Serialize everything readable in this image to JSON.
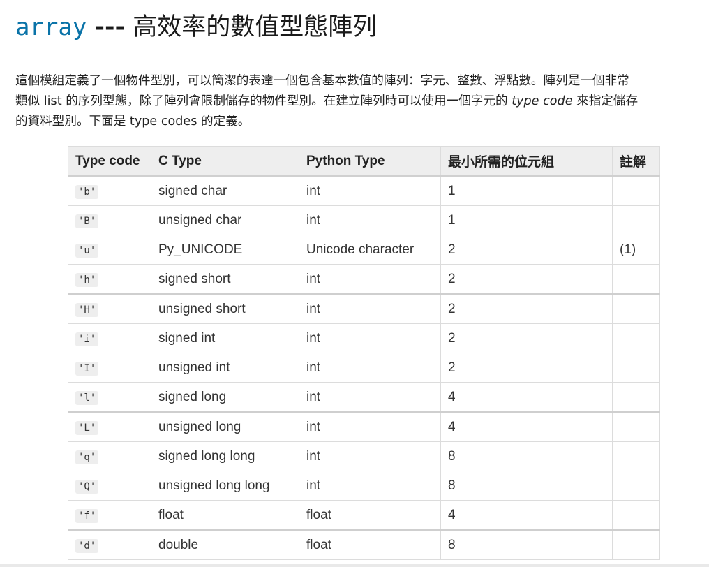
{
  "heading": {
    "module": "array",
    "dash": "---",
    "text": "高效率的數值型態陣列"
  },
  "intro": {
    "line1": "這個模組定義了一個物件型別，可以簡潔的表達一個包含基本數值的陣列：字元、整數、浮點數。陣列是一個非常",
    "line2_a": "類似 list 的序列型態，除了陣列會限制儲存的物件型別。在建立陣列時可以使用一個字元的 ",
    "line2_em": "type code",
    "line2_b": " 來指定儲存",
    "line3": "的資料型別。下面是 type codes 的定義。"
  },
  "table": {
    "headers": {
      "type_code": "Type code",
      "c_type": "C Type",
      "python_type": "Python Type",
      "min_bytes": "最小所需的位元組",
      "notes": "註解"
    },
    "rows": [
      {
        "code": "'b'",
        "ctype": "signed char",
        "pytype": "int",
        "bytes": "1",
        "note": ""
      },
      {
        "code": "'B'",
        "ctype": "unsigned char",
        "pytype": "int",
        "bytes": "1",
        "note": ""
      },
      {
        "code": "'u'",
        "ctype": "Py_UNICODE",
        "pytype": "Unicode character",
        "bytes": "2",
        "note": "(1)"
      },
      {
        "code": "'h'",
        "ctype": "signed short",
        "pytype": "int",
        "bytes": "2",
        "note": ""
      },
      {
        "code": "'H'",
        "ctype": "unsigned short",
        "pytype": "int",
        "bytes": "2",
        "note": ""
      },
      {
        "code": "'i'",
        "ctype": "signed int",
        "pytype": "int",
        "bytes": "2",
        "note": ""
      },
      {
        "code": "'I'",
        "ctype": "unsigned int",
        "pytype": "int",
        "bytes": "2",
        "note": ""
      },
      {
        "code": "'l'",
        "ctype": "signed long",
        "pytype": "int",
        "bytes": "4",
        "note": ""
      },
      {
        "code": "'L'",
        "ctype": "unsigned long",
        "pytype": "int",
        "bytes": "4",
        "note": ""
      },
      {
        "code": "'q'",
        "ctype": "signed long long",
        "pytype": "int",
        "bytes": "8",
        "note": ""
      },
      {
        "code": "'Q'",
        "ctype": "unsigned long long",
        "pytype": "int",
        "bytes": "8",
        "note": ""
      },
      {
        "code": "'f'",
        "ctype": "float",
        "pytype": "float",
        "bytes": "4",
        "note": ""
      },
      {
        "code": "'d'",
        "ctype": "double",
        "pytype": "float",
        "bytes": "8",
        "note": ""
      }
    ]
  }
}
